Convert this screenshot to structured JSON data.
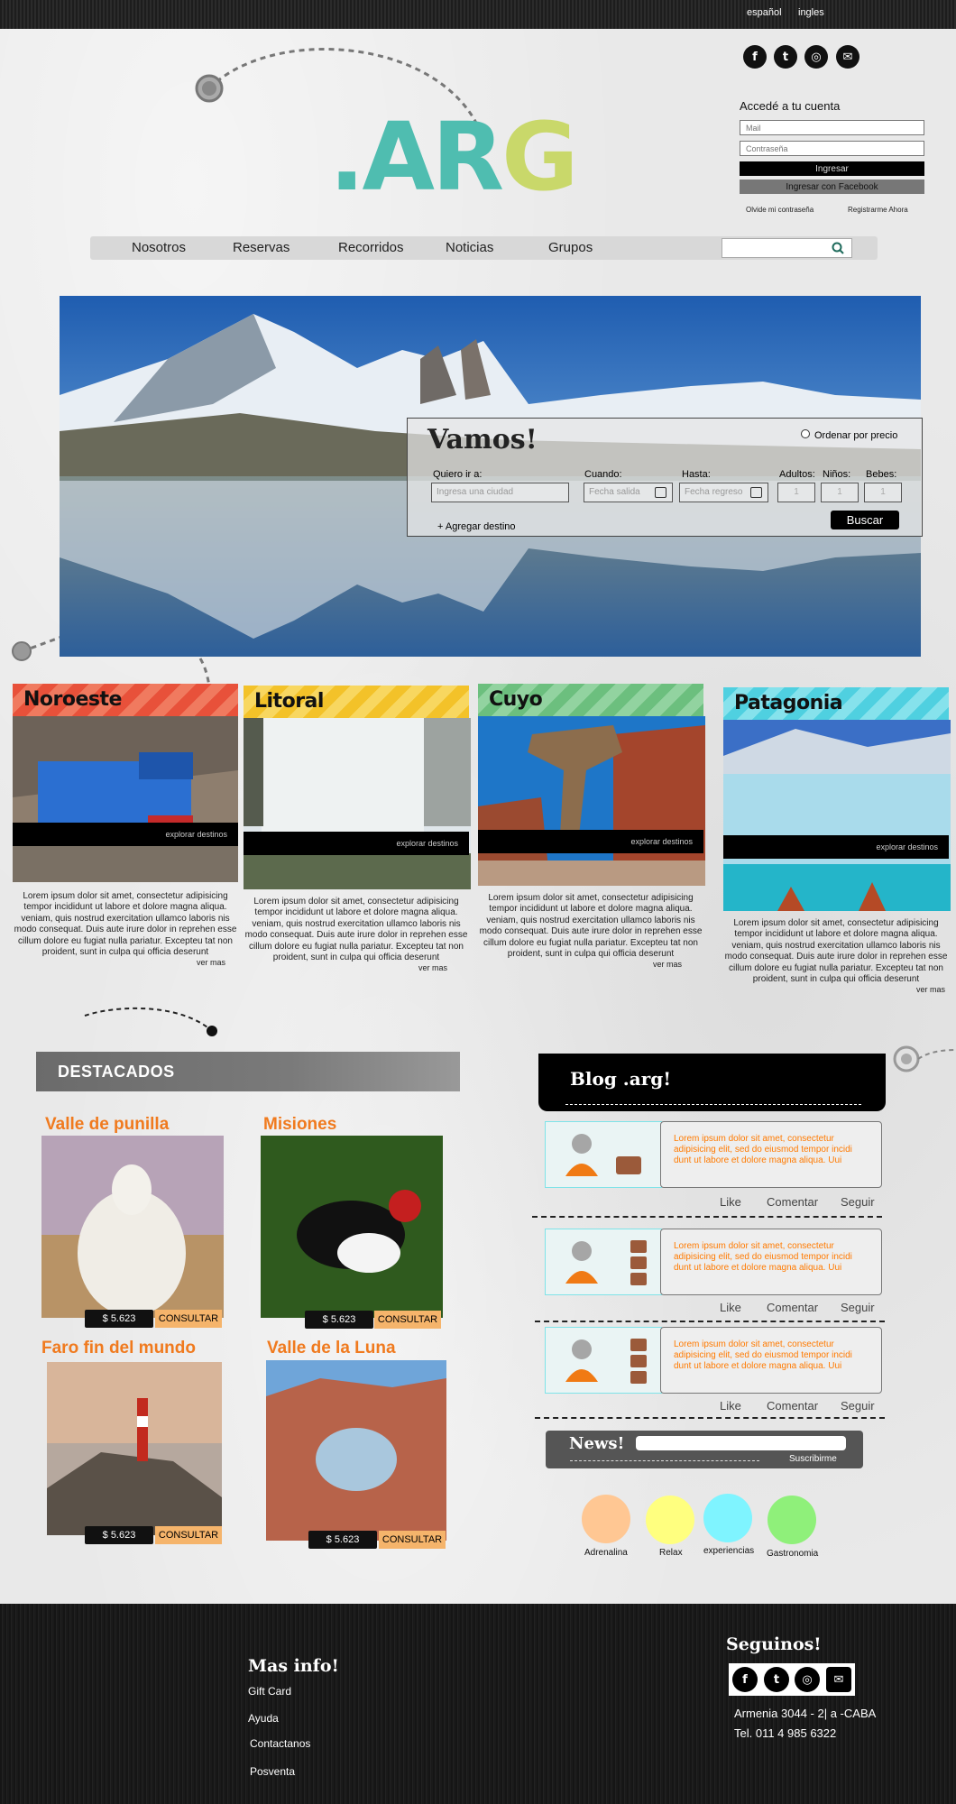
{
  "top_bar": {
    "lang_es": "español",
    "lang_en": "ingles"
  },
  "social": {
    "facebook": "f",
    "twitter": "t",
    "instagram": "◎",
    "mail": "✉"
  },
  "logo": {
    "text_main": ".AR",
    "text_accent": "G"
  },
  "login": {
    "title": "Accedé a tu cuenta",
    "mail_placeholder": "Mail",
    "password_placeholder": "Contraseña",
    "login_button": "Ingresar",
    "facebook_button": "Ingresar con Facebook",
    "forgot": "Olvide mi contraseña",
    "register": "Registrarme Ahora"
  },
  "nav": {
    "items": [
      "Nosotros",
      "Reservas",
      "Recorridos",
      "Noticias",
      "Grupos"
    ],
    "search_placeholder": ""
  },
  "search_box": {
    "title": "Vamos!",
    "sort_label": "Ordenar por precio",
    "destination_label": "Quiero ir a:",
    "destination_placeholder": "Ingresa una ciudad",
    "when_label": "Cuando:",
    "when_placeholder": "Fecha salida",
    "until_label": "Hasta:",
    "until_placeholder": "Fecha regreso",
    "adults_label": "Adultos:",
    "children_label": "Niños:",
    "babies_label": "Bebes:",
    "select_value": "1",
    "add_destination": "+ Agregar destino",
    "search_button": "Buscar"
  },
  "regions": [
    {
      "name": "Noroeste",
      "explore": "explorar destinos",
      "text": "Lorem ipsum dolor sit amet, consectetur adipisicing tempor incididunt ut labore et dolore magna aliqua. veniam, quis nostrud exercitation ullamco laboris nis modo consequat. Duis aute irure dolor in reprehen esse cillum dolore eu fugiat nulla pariatur. Excepteu tat non proident, sunt in culpa qui officia deserunt",
      "more": "ver mas",
      "color": "#e8513a"
    },
    {
      "name": "Litoral",
      "explore": "explorar destinos",
      "text": "Lorem ipsum dolor sit amet, consectetur adipisicing tempor incididunt ut labore et dolore magna aliqua. veniam, quis nostrud exercitation ullamco laboris nis modo consequat. Duis aute irure dolor in reprehen esse cillum dolore eu fugiat nulla pariatur. Excepteu tat non proident, sunt in culpa qui officia deserunt",
      "more": "ver mas",
      "color": "#f3c229"
    },
    {
      "name": "Cuyo",
      "explore": "explorar destinos",
      "text": "Lorem ipsum dolor sit amet, consectetur adipisicing tempor incididunt ut labore et dolore magna aliqua. veniam, quis nostrud exercitation ullamco laboris nis modo consequat. Duis aute irure dolor in reprehen esse cillum dolore eu fugiat nulla pariatur. Excepteu tat non proident, sunt in culpa qui officia deserunt",
      "more": "ver mas",
      "color": "#6cbf7e"
    },
    {
      "name": "Patagonia",
      "explore": "explorar destinos",
      "text": "Lorem ipsum dolor sit amet, consectetur adipisicing tempor incididunt ut labore et dolore magna aliqua. veniam, quis nostrud exercitation ullamco laboris nis modo consequat. Duis aute irure dolor in reprehen esse cillum dolore eu fugiat nulla pariatur. Excepteu tat non proident, sunt in culpa qui officia deserunt",
      "more": "ver mas",
      "color": "#4fd0e0"
    }
  ],
  "destacados": {
    "title": "DESTACADOS",
    "items": [
      {
        "title": "Valle de punilla",
        "price": "$ 5.623",
        "cta": "CONSULTAR"
      },
      {
        "title": "Misiones",
        "price": "$ 5.623",
        "cta": "CONSULTAR"
      },
      {
        "title": "Faro fin del mundo",
        "price": "$ 5.623",
        "cta": "CONSULTAR"
      },
      {
        "title": "Valle de la Luna",
        "price": "$ 5.623",
        "cta": "CONSULTAR"
      }
    ]
  },
  "blog": {
    "title": "Blog .arg!",
    "posts": [
      {
        "text": "Lorem ipsum dolor sit amet, consectetur adipisicing elit, sed do eiusmod tempor incidi dunt ut labore et dolore magna aliqua. Uui"
      },
      {
        "text": "Lorem ipsum dolor sit amet, consectetur adipisicing elit, sed do eiusmod tempor incidi dunt ut labore et dolore magna aliqua. Uui"
      },
      {
        "text": "Lorem ipsum dolor sit amet, consectetur adipisicing elit, sed do eiusmod tempor incidi dunt ut labore et dolore magna aliqua. Uui"
      }
    ],
    "like": "Like",
    "comment": "Comentar",
    "follow": "Seguir"
  },
  "news": {
    "title": "News!",
    "subscribe": "Suscribirme"
  },
  "categories": [
    {
      "label": "Adrenalina",
      "color": "#ffc793"
    },
    {
      "label": "Relax",
      "color": "#ffff7f"
    },
    {
      "label": "experiencias",
      "color": "#7ff4ff"
    },
    {
      "label": "Gastronomia",
      "color": "#8ff07a"
    }
  ],
  "footer": {
    "info_title": "Mas info!",
    "links": [
      "Gift Card",
      "Ayuda",
      "Contactanos",
      "Posventa"
    ],
    "follow_title": "Seguinos!",
    "address": "Armenia 3044 - 2| a -CABA",
    "phone": "Tel. 011 4 985 6322"
  }
}
